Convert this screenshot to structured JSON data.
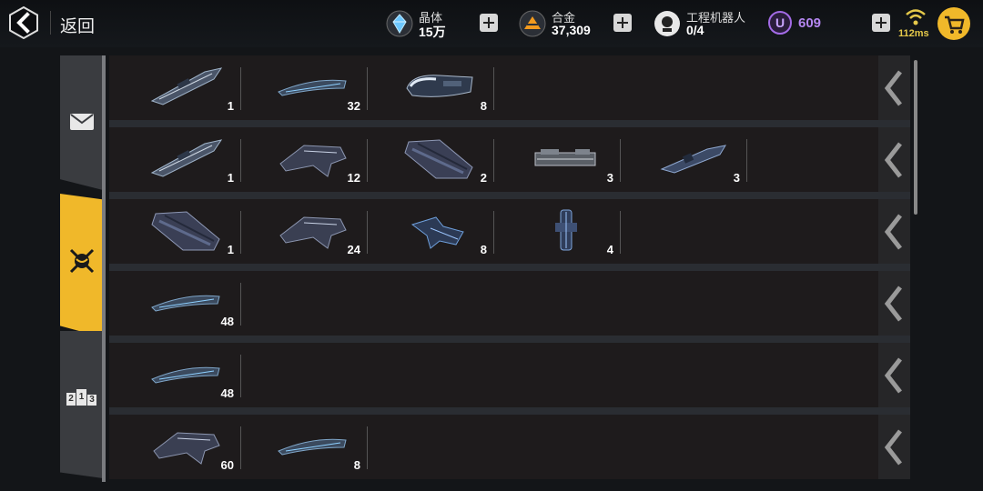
{
  "header": {
    "back_label": "返回",
    "resources": [
      {
        "name": "晶体",
        "value": "15万",
        "icon": "crystal-icon"
      },
      {
        "name": "合金",
        "value": "37,309",
        "icon": "alloy-icon"
      },
      {
        "name": "工程机器人",
        "value": "0/4",
        "icon": "robot-icon"
      }
    ],
    "premium": {
      "symbol": "U",
      "value": "609"
    },
    "ping": "112ms"
  },
  "sidebar": {
    "tabs": [
      {
        "name": "mail",
        "icon": "envelope-icon",
        "active": false
      },
      {
        "name": "battle",
        "icon": "crossed-swords-icon",
        "active": true
      },
      {
        "name": "ranking",
        "icon": "podium-icon",
        "active": false,
        "icon_text": "213"
      }
    ]
  },
  "rows": [
    {
      "items": [
        {
          "ship": "destroyer",
          "qty": "1"
        },
        {
          "ship": "frigate",
          "qty": "32"
        },
        {
          "ship": "cruiser",
          "qty": "8"
        }
      ]
    },
    {
      "items": [
        {
          "ship": "destroyer",
          "qty": "1"
        },
        {
          "ship": "gunship",
          "qty": "12"
        },
        {
          "ship": "battleship",
          "qty": "2"
        },
        {
          "ship": "carrier",
          "qty": "3"
        },
        {
          "ship": "corvette",
          "qty": "3"
        }
      ]
    },
    {
      "items": [
        {
          "ship": "battleship",
          "qty": "1"
        },
        {
          "ship": "gunship",
          "qty": "24"
        },
        {
          "ship": "fighter",
          "qty": "8"
        },
        {
          "ship": "mecha",
          "qty": "4"
        }
      ]
    },
    {
      "items": [
        {
          "ship": "frigate",
          "qty": "48"
        }
      ]
    },
    {
      "items": [
        {
          "ship": "frigate",
          "qty": "48"
        }
      ]
    },
    {
      "items": [
        {
          "ship": "gunship",
          "qty": "60"
        },
        {
          "ship": "frigate",
          "qty": "8"
        }
      ]
    }
  ],
  "colors": {
    "accent": "#f0b82a",
    "premium": "#b486f0",
    "ping": "#e6c94a"
  }
}
